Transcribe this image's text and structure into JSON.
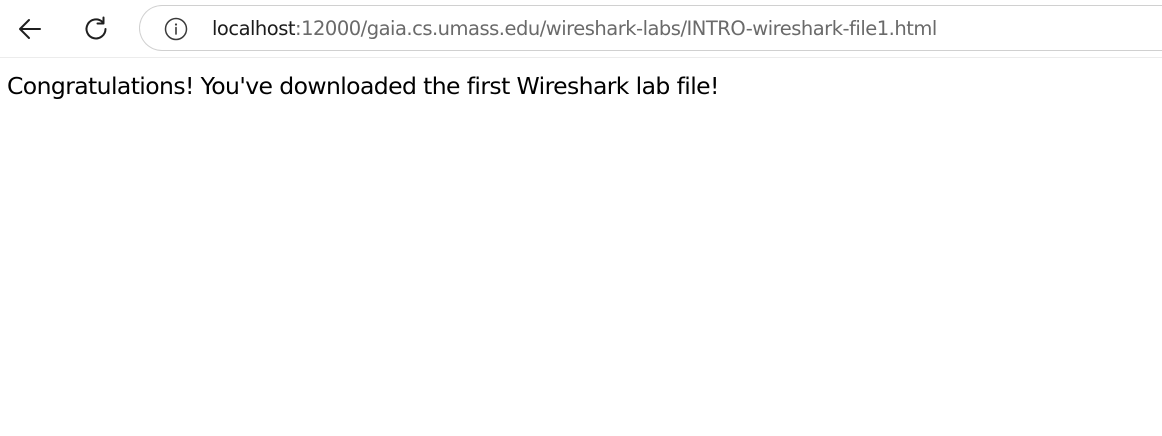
{
  "browser": {
    "icons": {
      "back": "arrow-left-icon",
      "reload": "reload-icon",
      "site_info": "info-circle-icon"
    },
    "address_bar": {
      "host": "localhost",
      "path": ":12000/gaia.cs.umass.edu/wireshark-labs/INTRO-wireshark-file1.html"
    }
  },
  "page": {
    "message": "Congratulations! You've downloaded the first Wireshark lab file!"
  }
}
